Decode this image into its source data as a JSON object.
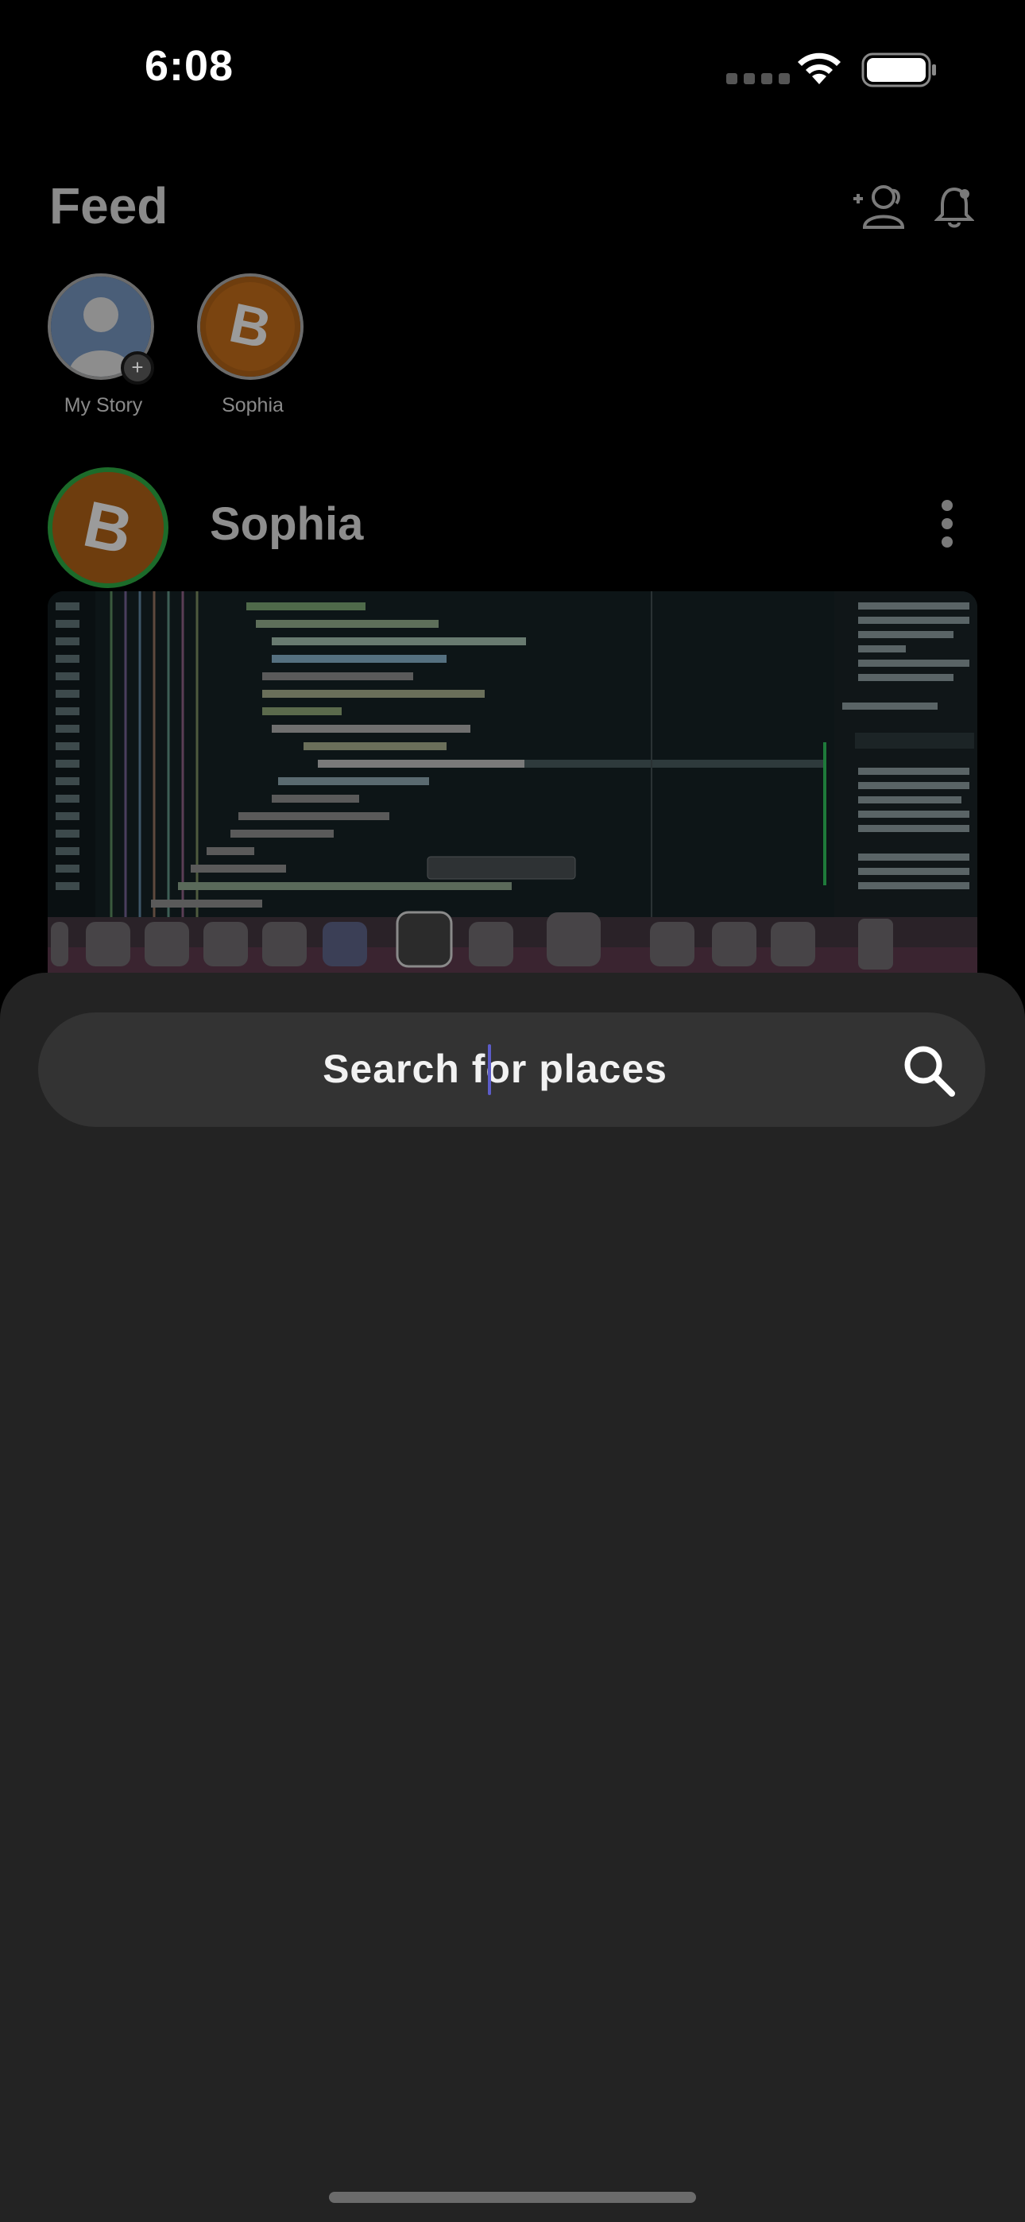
{
  "status_bar": {
    "time": "6:08"
  },
  "feed": {
    "title": "Feed",
    "stories": [
      {
        "label": "My Story"
      },
      {
        "label": "Sophia"
      }
    ],
    "post": {
      "author": "Sophia"
    }
  },
  "search": {
    "placeholder": "Search for places",
    "value": ""
  },
  "icons": {
    "add_friend": "add-friend-icon",
    "notifications": "bell-icon",
    "more": "more-vertical-icon",
    "search": "search-icon"
  },
  "colors": {
    "sheet": "#232323",
    "search_bar": "#333333",
    "avatar_ring_active": "#1c6b2a",
    "caret": "#5c5cc8"
  }
}
